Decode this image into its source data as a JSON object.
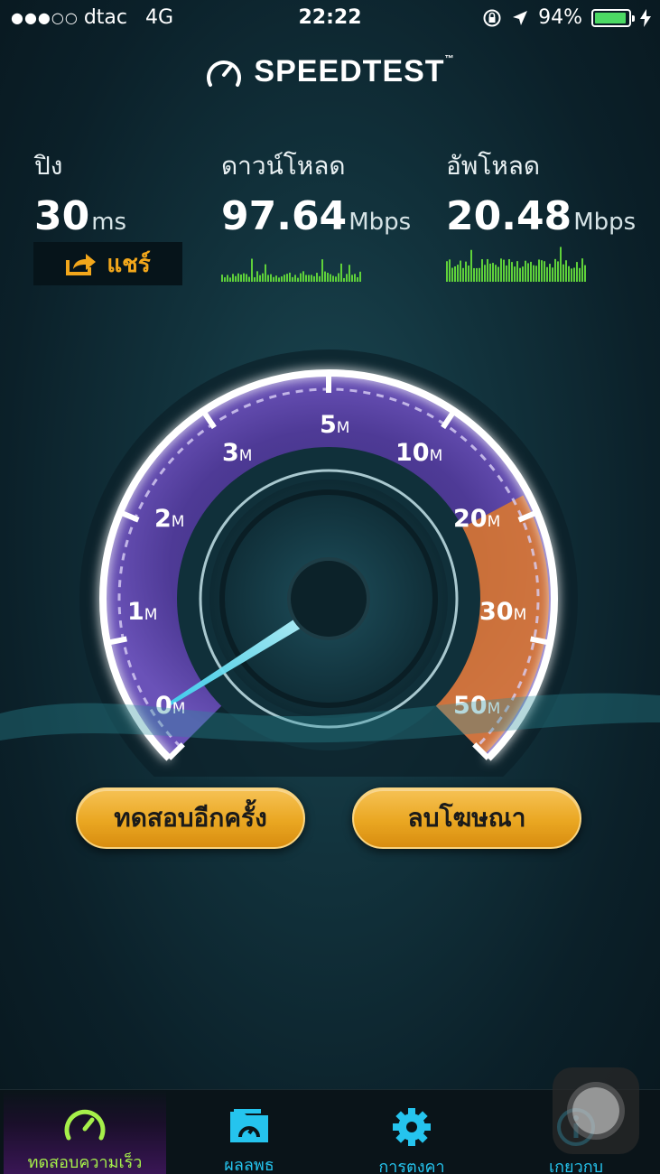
{
  "status_bar": {
    "signal": "●●●○○",
    "carrier": "dtac",
    "network": "4G",
    "time": "22:22",
    "battery_percent": "94%",
    "battery_level": 0.94
  },
  "logo": {
    "text": "SPEEDTEST",
    "tm": "™"
  },
  "stats": {
    "ping": {
      "label": "ปิง",
      "value": "30",
      "unit": "ms"
    },
    "download": {
      "label": "ดาวน์โหลด",
      "value": "97.64",
      "unit": "Mbps"
    },
    "upload": {
      "label": "อัพโหลด",
      "value": "20.48",
      "unit": "Mbps"
    }
  },
  "share": {
    "label": "แชร์"
  },
  "gauge": {
    "ticks": [
      {
        "num": "0",
        "unit": "M"
      },
      {
        "num": "1",
        "unit": "M"
      },
      {
        "num": "2",
        "unit": "M"
      },
      {
        "num": "3",
        "unit": "M"
      },
      {
        "num": "5",
        "unit": "M"
      },
      {
        "num": "10",
        "unit": "M"
      },
      {
        "num": "20",
        "unit": "M"
      },
      {
        "num": "30",
        "unit": "M"
      },
      {
        "num": "50",
        "unit": "M"
      }
    ],
    "colors": {
      "arc": "#5a3f9e",
      "active": "#e07a2a",
      "needle": "#7fe6f5"
    }
  },
  "buttons": {
    "retest": "ทดสอบอีกครั้ง",
    "remove_ads": "ลบโฆษณา"
  },
  "tabs": [
    {
      "label": "ทดสอบความเร็ว",
      "icon": "speedometer-icon"
    },
    {
      "label": "ผลลพธ",
      "icon": "folder-results-icon"
    },
    {
      "label": "การตงคา",
      "icon": "gear-icon"
    },
    {
      "label": "เกยวกบ",
      "icon": "info-icon"
    }
  ]
}
